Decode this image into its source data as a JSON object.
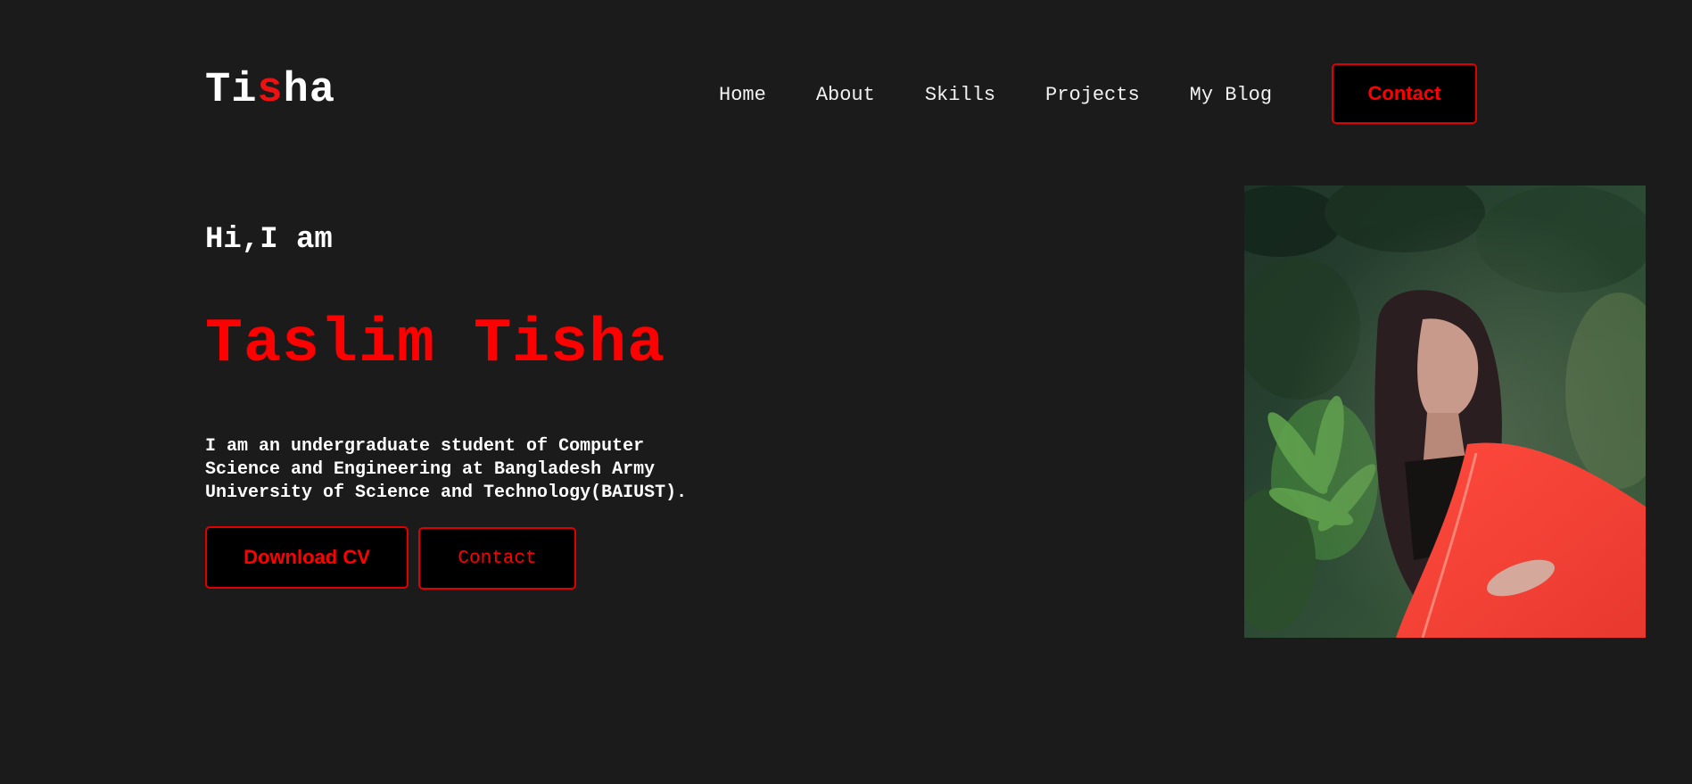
{
  "logo": {
    "part1": "Ti",
    "accent": "s",
    "part2": "ha"
  },
  "nav": {
    "items": [
      {
        "label": "Home"
      },
      {
        "label": "About"
      },
      {
        "label": "Skills"
      },
      {
        "label": "Projects"
      },
      {
        "label": "My Blog"
      }
    ],
    "contact_label": "Contact"
  },
  "hero": {
    "greeting": "Hi,I am",
    "name": "Taslim Tisha",
    "bio_lines": [
      "I am an undergraduate student of Computer",
      "Science and Engineering at Bangladesh Army",
      "University of Science and Technology(BAIUST)."
    ],
    "download_cv_label": "Download CV",
    "contact_label": "Contact"
  },
  "colors": {
    "background": "#1b1b1b",
    "accent": "#ff0000",
    "button_bg": "#000000",
    "text": "#ffffff"
  }
}
